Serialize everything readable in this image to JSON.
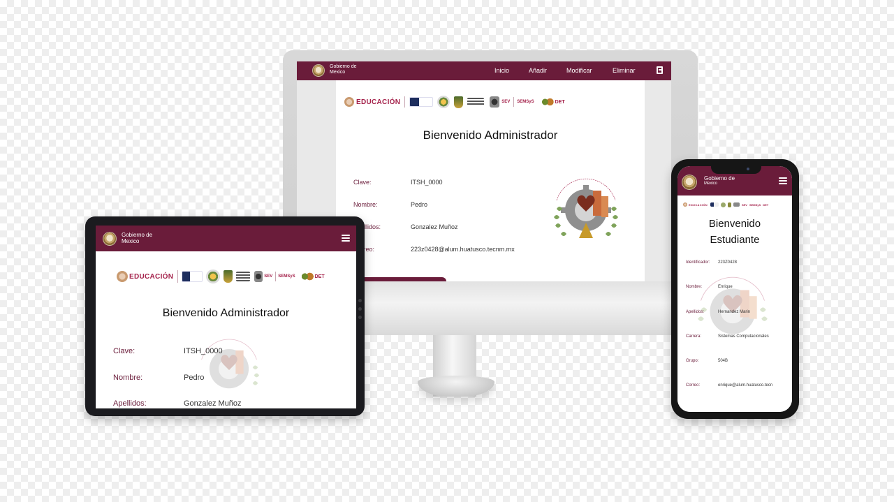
{
  "header": {
    "gov_line1": "Gobierno de",
    "gov_line2": "Mexico",
    "brand_color": "#6a1c3a"
  },
  "desktop": {
    "nav": [
      "Inicio",
      "Añadir",
      "Modificar",
      "Eliminar"
    ],
    "logout_icon": "exit-icon",
    "welcome": "Bienvenido Administrador",
    "fields": [
      {
        "label": "Clave:",
        "value": "ITSH_0000"
      },
      {
        "label": "Nombre:",
        "value": "Pedro"
      },
      {
        "label": "Apellidos:",
        "value": "Gonzalez Muñoz"
      },
      {
        "label": "Correo:",
        "value": "223z0428@alum.huatusco.tecnm.mx"
      }
    ]
  },
  "tablet": {
    "welcome": "Bienvenido Administrador",
    "fields": [
      {
        "label": "Clave:",
        "value": "ITSH_0000"
      },
      {
        "label": "Nombre:",
        "value": "Pedro"
      },
      {
        "label": "Apellidos:",
        "value": "Gonzalez Muñoz"
      }
    ]
  },
  "phone": {
    "welcome_line1": "Bienvenido",
    "welcome_line2": "Estudiante",
    "fields": [
      {
        "label": "Identificador:",
        "value": "223Z0428"
      },
      {
        "label": "Nombre:",
        "value": "Enrique"
      },
      {
        "label": "Apellidos:",
        "value": "Hernandez Marin"
      },
      {
        "label": "Carrera:",
        "value": "Sistemas Computacionales"
      },
      {
        "label": "Grupo:",
        "value": "504B"
      },
      {
        "label": "Correo:",
        "value": "enrique@alum.huatusco.tecn"
      }
    ]
  },
  "logos": {
    "educacion": "EDUCACIÓN",
    "sev": "SEV",
    "semsys": "SEMSyS",
    "det": "DET"
  },
  "watermark_text": "Instituto Tecnológico Superior de Huatusco"
}
